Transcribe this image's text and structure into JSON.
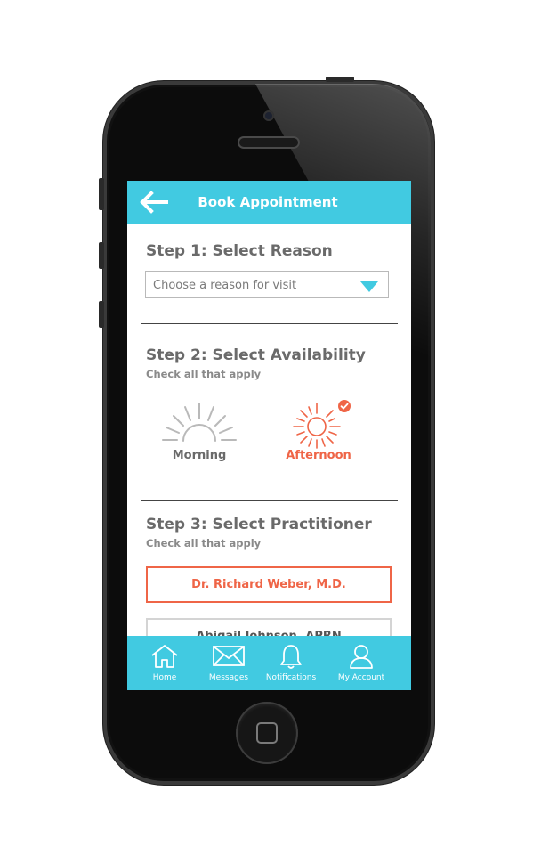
{
  "header": {
    "back_icon": "arrow-left-icon",
    "title": "Book Appointment"
  },
  "step1": {
    "title": "Step 1: Select Reason",
    "dropdown_value": "Choose a reason for visit",
    "dropdown_icon": "caret-down-icon"
  },
  "step2": {
    "title": "Step 2: Select Availability",
    "subtitle": "Check all that apply",
    "options": [
      {
        "label": "Morning",
        "icon": "sunrise-icon",
        "selected": false
      },
      {
        "label": "Afternoon",
        "icon": "sun-icon",
        "selected": true
      }
    ]
  },
  "step3": {
    "title": "Step 3: Select Practitioner",
    "subtitle": "Check all that apply",
    "practitioners": [
      {
        "name": "Dr. Richard Weber, M.D.",
        "selected": true
      },
      {
        "name": "Abigail Johnson, APRN",
        "selected": false
      }
    ]
  },
  "tabbar": {
    "items": [
      {
        "label": "Home",
        "icon": "home-icon"
      },
      {
        "label": "Messages",
        "icon": "envelope-icon"
      },
      {
        "label": "Notifications",
        "icon": "bell-icon"
      },
      {
        "label": "My Account",
        "icon": "user-icon"
      }
    ]
  },
  "colors": {
    "accent": "#41cae1",
    "selected": "#ef6547",
    "text": "#6a6a6a",
    "muted": "#8a8a8a"
  }
}
